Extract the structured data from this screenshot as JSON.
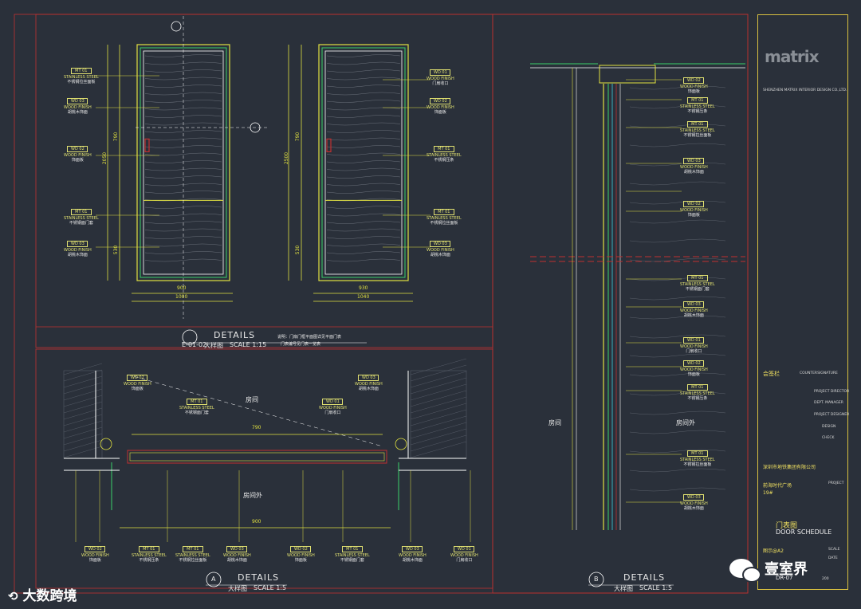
{
  "drawing": {
    "details": [
      {
        "id": "E-01-02",
        "title": "DETAILS",
        "sub": "大样图",
        "scale": "SCALE 1:15",
        "note1": "说明：门扇门框平面图详见平面门表",
        "note2": "门表编号见门表一览表"
      },
      {
        "id": "A",
        "title": "DETAILS",
        "sub": "大样图",
        "scale": "SCALE 1:5"
      },
      {
        "id": "B",
        "title": "DETAILS",
        "sub": "大样图",
        "scale": "SCALE 1:5"
      }
    ],
    "elevation_dims": {
      "left_width_inner": "900",
      "left_width_total": "1000",
      "right_width_inner": "930",
      "right_width_total": "1040",
      "height_left": "2050",
      "height_right": "2500",
      "upper": "790",
      "lower": "530"
    },
    "plan_dims": {
      "top": "790",
      "bottom": "900",
      "s1": "10",
      "s2": "50",
      "s3": "30",
      "s4": "15"
    },
    "rooms": {
      "room": "房间",
      "outside": "房间外"
    },
    "tags": [
      {
        "code": "MT 01",
        "l1": "STAINLESS STEEL",
        "l2": "不锈钢拉丝面板"
      },
      {
        "code": "WD 03",
        "l1": "WOOD FINISH",
        "l2": "胡桃木饰面"
      },
      {
        "code": "WD 02",
        "l1": "WOOD FINISH",
        "l2": "饰面板"
      },
      {
        "code": "MT 01",
        "l1": "STAINLESS STEEL",
        "l2": "不锈钢面门套"
      },
      {
        "code": "WD 03",
        "l1": "WOOD FINISH",
        "l2": "胡桃木饰面"
      },
      {
        "code": "WD 01",
        "l1": "WOOD FINISH",
        "l2": "门扇收口"
      },
      {
        "code": "WD 02",
        "l1": "WOOD FINISH",
        "l2": "饰面板"
      },
      {
        "code": "MT 01",
        "l1": "STAINLESS STEEL",
        "l2": "不锈钢压条"
      }
    ]
  },
  "title_block": {
    "logo": "matrix",
    "company": "SHENZHEN MATRIX INTERIOR DESIGN CO.,LTD.",
    "counter": "COUNTERSIGNATURE",
    "counter_cn": "会签栏",
    "roles": [
      "PROJECT DIRECTOR",
      "DEPT. MANAGER",
      "PROJECT DESIGNER",
      "DESIGN",
      "CHECK"
    ],
    "client": "深圳市地铁集团有限公司",
    "project_cn": "前海时代广场",
    "project_num": "19#",
    "project_label": "PROJECT",
    "drawing_cn": "门表图",
    "drawing_en": "DOOR SCHEDULE",
    "sheet": "图示@A2",
    "sheet_no": "DR-07",
    "scale_label": "SCALE",
    "date_label": "DATE",
    "number": "200"
  },
  "watermark": {
    "left": "大数跨境",
    "right": "壹室界"
  },
  "colors": {
    "bg": "#2a303a",
    "frame": "#c03030",
    "dim": "#e0e040",
    "line": "#ffffff",
    "wall": "#3bd06a",
    "cyan": "#3fd0e0",
    "blue": "#3050d0"
  }
}
